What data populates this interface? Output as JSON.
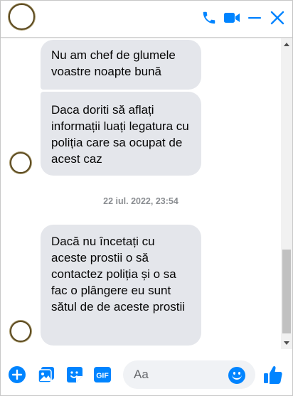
{
  "header": {
    "contact_avatar": "contact-avatar",
    "icons": [
      "phone-icon",
      "video-camera-icon",
      "minimize-icon",
      "close-icon"
    ],
    "accent_color": "#0084ff"
  },
  "messages": [
    {
      "text": "Nu am chef de glumele voastre  noapte bună"
    },
    {
      "text": "Daca doriti să aflați informații luați legatura cu poliția care sa ocupat de acest caz"
    },
    {
      "text": "Dacă nu încetați cu aceste prostii o să contactez poliția și o sa fac o plângere eu sunt sătul de de aceste prostii"
    }
  ],
  "timestamp": "22 iul. 2022, 23:54",
  "composer": {
    "placeholder": "Aa",
    "icons": [
      "plus-icon",
      "image-icon",
      "sticker-icon",
      "gif-icon",
      "emoji-icon",
      "thumbs-up-icon"
    ],
    "gif_label": "GIF"
  },
  "colors": {
    "bubble_background": "#e4e6eb",
    "accent": "#0084ff",
    "timestamp": "#8a8d91"
  }
}
